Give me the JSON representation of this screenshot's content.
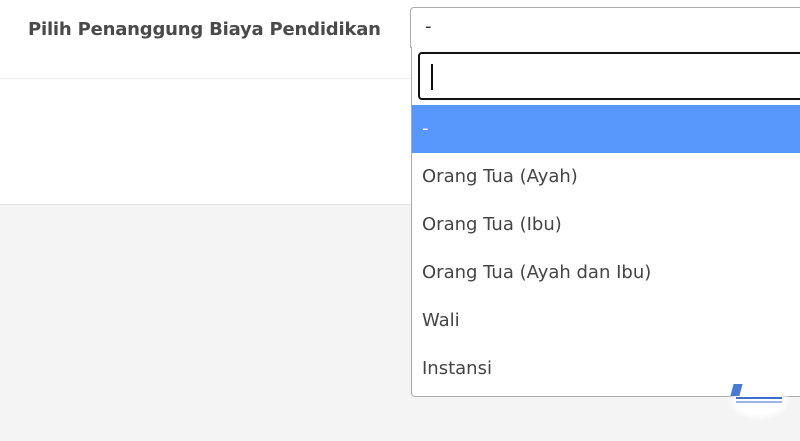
{
  "form": {
    "label": "Pilih Penanggung Biaya Pendidikan",
    "selected_value": "-"
  },
  "dropdown": {
    "search_value": "",
    "options": [
      {
        "label": "-",
        "highlighted": true
      },
      {
        "label": "Orang Tua (Ayah)",
        "highlighted": false
      },
      {
        "label": "Orang Tua (Ibu)",
        "highlighted": false
      },
      {
        "label": "Orang Tua (Ayah dan Ibu)",
        "highlighted": false
      },
      {
        "label": "Wali",
        "highlighted": false
      },
      {
        "label": "Instansi",
        "highlighted": false
      }
    ]
  },
  "colors": {
    "highlight": "#5897fb",
    "panel_background": "#ffffff",
    "page_background": "#f4f4f4"
  }
}
